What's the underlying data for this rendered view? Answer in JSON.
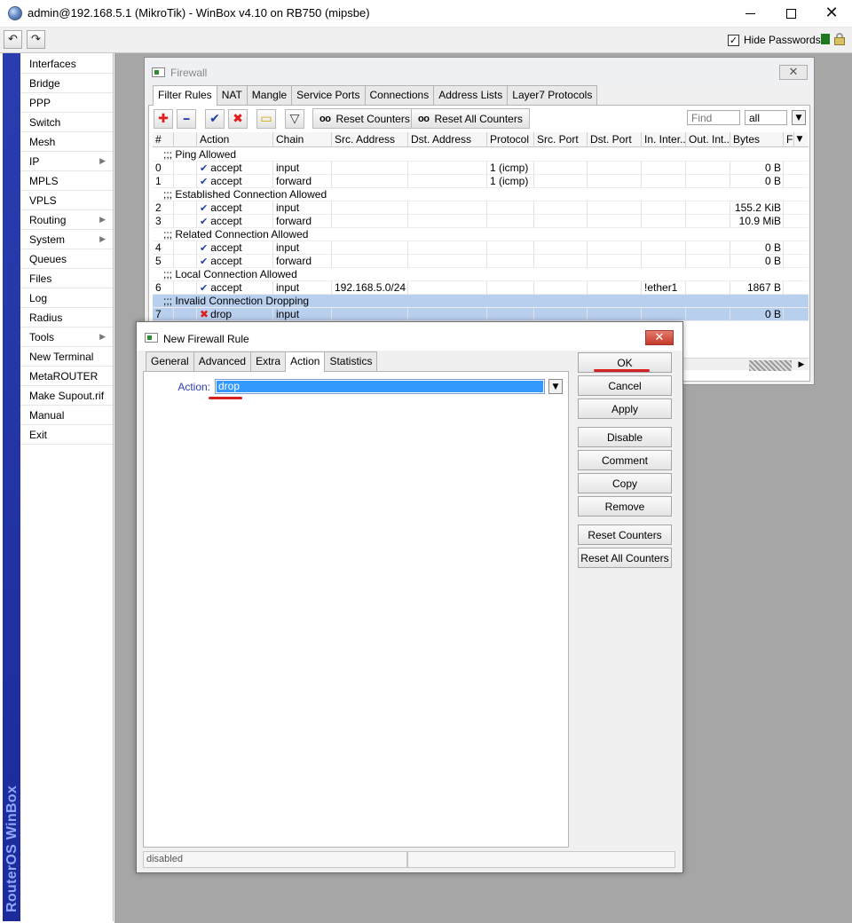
{
  "window": {
    "title": "admin@192.168.5.1 (MikroTik) - WinBox v4.10 on RB750 (mipsbe)",
    "minimize_glyph": "",
    "maximize_glyph": "",
    "close_glyph": "✕"
  },
  "toolbar": {
    "undo_glyph": "↶",
    "redo_glyph": "↷",
    "hide_passwords_label": "Hide Passwords",
    "hide_passwords_checked": "✓"
  },
  "sidebar": {
    "brand": "RouterOS WinBox",
    "items": [
      {
        "label": "Interfaces",
        "arrow": ""
      },
      {
        "label": "Bridge",
        "arrow": ""
      },
      {
        "label": "PPP",
        "arrow": ""
      },
      {
        "label": "Switch",
        "arrow": ""
      },
      {
        "label": "Mesh",
        "arrow": ""
      },
      {
        "label": "IP",
        "arrow": "▶"
      },
      {
        "label": "MPLS",
        "arrow": ""
      },
      {
        "label": "VPLS",
        "arrow": ""
      },
      {
        "label": "Routing",
        "arrow": "▶"
      },
      {
        "label": "System",
        "arrow": "▶"
      },
      {
        "label": "Queues",
        "arrow": ""
      },
      {
        "label": "Files",
        "arrow": ""
      },
      {
        "label": "Log",
        "arrow": ""
      },
      {
        "label": "Radius",
        "arrow": ""
      },
      {
        "label": "Tools",
        "arrow": "▶"
      },
      {
        "label": "New Terminal",
        "arrow": ""
      },
      {
        "label": "MetaROUTER",
        "arrow": ""
      },
      {
        "label": "Make Supout.rif",
        "arrow": ""
      },
      {
        "label": "Manual",
        "arrow": ""
      },
      {
        "label": "Exit",
        "arrow": ""
      }
    ]
  },
  "firewall": {
    "title": "Firewall",
    "close_glyph": "✕",
    "tabs": [
      "Filter Rules",
      "NAT",
      "Mangle",
      "Service Ports",
      "Connections",
      "Address Lists",
      "Layer7 Protocols"
    ],
    "buttons": {
      "add_glyph": "✚",
      "remove_glyph": "━",
      "enable_glyph": "✔",
      "disable_glyph": "✖",
      "comment_glyph": "▭",
      "filter_glyph": "▽",
      "oo": "oo",
      "reset_counters": "Reset Counters",
      "reset_all_counters": "Reset All Counters"
    },
    "find_placeholder": "Find",
    "filter_value": "all",
    "dropdown_glyph": "▼",
    "columns": [
      "#",
      "",
      "Action",
      "Chain",
      "Src. Address",
      "Dst. Address",
      "Protocol",
      "Src. Port",
      "Dst. Port",
      "In. Inter...",
      "Out. Int...",
      "Bytes",
      "F"
    ],
    "rows": [
      {
        "type": "comment",
        "text": ";;; Ping Allowed"
      },
      {
        "type": "rule",
        "num": "0",
        "icon": "✔",
        "action": "accept",
        "chain": "input",
        "src": "",
        "dst": "",
        "proto": "1 (icmp)",
        "sport": "",
        "dport": "",
        "inif": "",
        "outif": "",
        "bytes": "0 B"
      },
      {
        "type": "rule",
        "num": "1",
        "icon": "✔",
        "action": "accept",
        "chain": "forward",
        "src": "",
        "dst": "",
        "proto": "1 (icmp)",
        "sport": "",
        "dport": "",
        "inif": "",
        "outif": "",
        "bytes": "0 B"
      },
      {
        "type": "comment",
        "text": ";;; Established Connection Allowed"
      },
      {
        "type": "rule",
        "num": "2",
        "icon": "✔",
        "action": "accept",
        "chain": "input",
        "src": "",
        "dst": "",
        "proto": "",
        "sport": "",
        "dport": "",
        "inif": "",
        "outif": "",
        "bytes": "155.2 KiB"
      },
      {
        "type": "rule",
        "num": "3",
        "icon": "✔",
        "action": "accept",
        "chain": "forward",
        "src": "",
        "dst": "",
        "proto": "",
        "sport": "",
        "dport": "",
        "inif": "",
        "outif": "",
        "bytes": "10.9 MiB"
      },
      {
        "type": "comment",
        "text": ";;; Related Connection Allowed"
      },
      {
        "type": "rule",
        "num": "4",
        "icon": "✔",
        "action": "accept",
        "chain": "input",
        "src": "",
        "dst": "",
        "proto": "",
        "sport": "",
        "dport": "",
        "inif": "",
        "outif": "",
        "bytes": "0 B"
      },
      {
        "type": "rule",
        "num": "5",
        "icon": "✔",
        "action": "accept",
        "chain": "forward",
        "src": "",
        "dst": "",
        "proto": "",
        "sport": "",
        "dport": "",
        "inif": "",
        "outif": "",
        "bytes": "0 B"
      },
      {
        "type": "comment",
        "text": ";;; Local Connection Allowed"
      },
      {
        "type": "rule",
        "num": "6",
        "icon": "✔",
        "action": "accept",
        "chain": "input",
        "src": "192.168.5.0/24",
        "dst": "",
        "proto": "",
        "sport": "",
        "dport": "",
        "inif": "!ether1",
        "outif": "",
        "bytes": "1867 B"
      },
      {
        "type": "comment",
        "text": ";;; Invalid Connection Dropping",
        "selected": true
      },
      {
        "type": "rule",
        "num": "7",
        "icon": "✖",
        "action": "drop",
        "chain": "input",
        "src": "",
        "dst": "",
        "proto": "",
        "sport": "",
        "dport": "",
        "inif": "",
        "outif": "",
        "bytes": "0 B",
        "selected": true
      }
    ],
    "scroll_right_glyph": "▶"
  },
  "dialog": {
    "title": "New Firewall Rule",
    "close_glyph": "✕",
    "tabs": [
      "General",
      "Advanced",
      "Extra",
      "Action",
      "Statistics"
    ],
    "active_tab": "Action",
    "action_label": "Action:",
    "action_value": "drop",
    "dropdown_glyph": "▼",
    "buttons": [
      "OK",
      "Cancel",
      "Apply",
      "Disable",
      "Comment",
      "Copy",
      "Remove",
      "Reset Counters",
      "Reset All Counters"
    ],
    "status": "disabled"
  }
}
